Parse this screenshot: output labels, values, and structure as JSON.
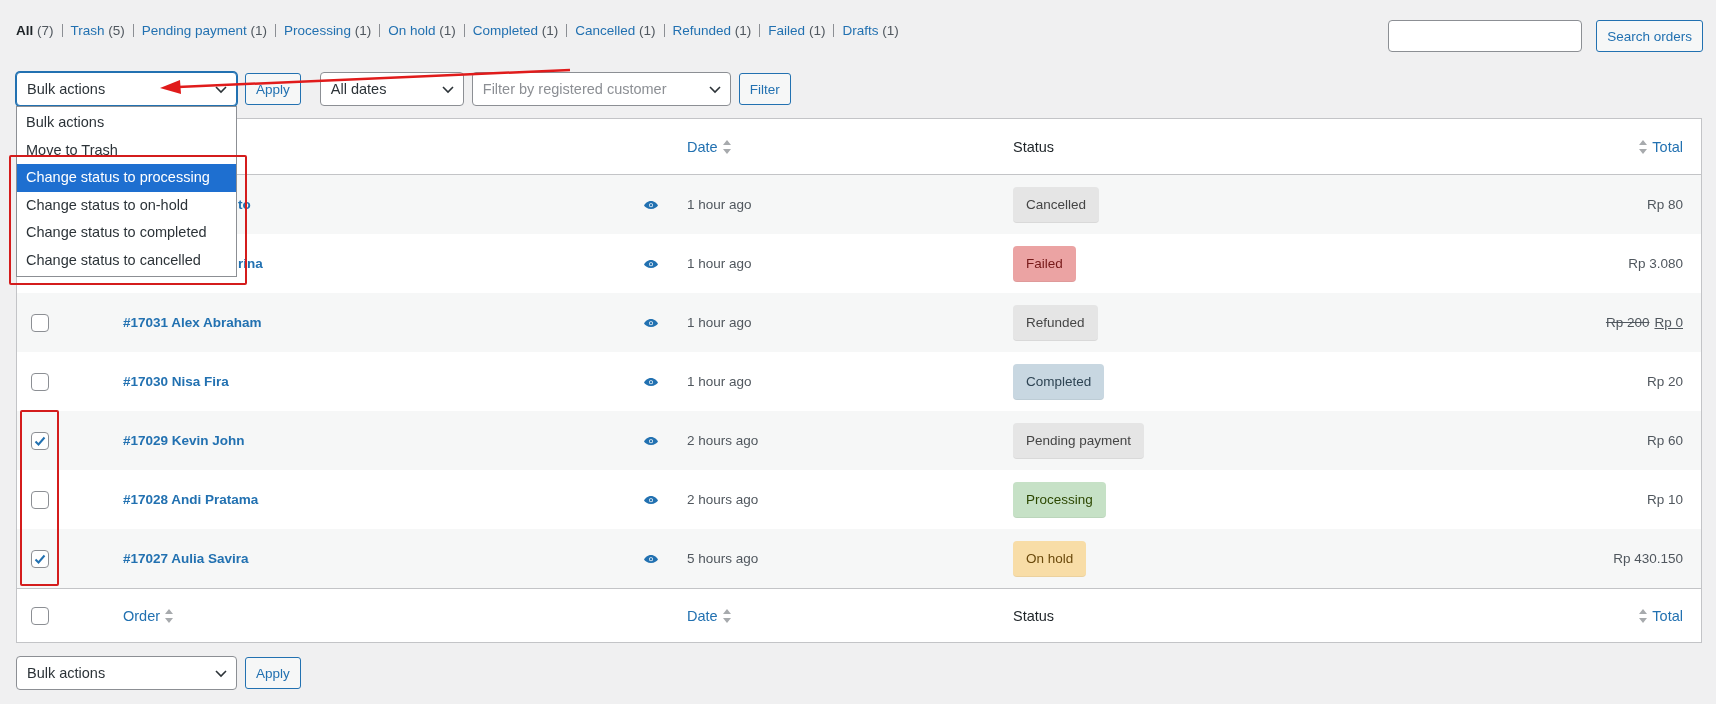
{
  "status_links": [
    {
      "label": "All",
      "count": "(7)",
      "selected": true
    },
    {
      "label": "Trash",
      "count": "(5)",
      "selected": false
    },
    {
      "label": "Pending payment",
      "count": "(1)",
      "selected": false
    },
    {
      "label": "Processing",
      "count": "(1)",
      "selected": false
    },
    {
      "label": "On hold",
      "count": "(1)",
      "selected": false
    },
    {
      "label": "Completed",
      "count": "(1)",
      "selected": false
    },
    {
      "label": "Cancelled",
      "count": "(1)",
      "selected": false
    },
    {
      "label": "Refunded",
      "count": "(1)",
      "selected": false
    },
    {
      "label": "Failed",
      "count": "(1)",
      "selected": false
    },
    {
      "label": "Drafts",
      "count": "(1)",
      "selected": false
    }
  ],
  "search": {
    "button": "Search orders"
  },
  "filters": {
    "bulk_action": "Bulk actions",
    "apply": "Apply",
    "dates": "All dates",
    "customer_placeholder": "Filter by registered customer",
    "filter": "Filter"
  },
  "bulk_menu": [
    {
      "label": "Bulk actions",
      "selected": false
    },
    {
      "label": "Move to Trash",
      "selected": false
    },
    {
      "label": "Change status to processing",
      "selected": true
    },
    {
      "label": "Change status to on-hold",
      "selected": false
    },
    {
      "label": "Change status to completed",
      "selected": false
    },
    {
      "label": "Change status to cancelled",
      "selected": false
    }
  ],
  "table": {
    "header": {
      "date": "Date",
      "status": "Status",
      "total": "Total"
    },
    "rows": [
      {
        "covered": true,
        "order": "to",
        "date": "1 hour ago",
        "status": {
          "label": "Cancelled",
          "kind": "cancelled",
          "color": "#e5e5e5"
        },
        "total": "Rp 80"
      },
      {
        "covered": true,
        "order": "rina",
        "date": "1 hour ago",
        "status": {
          "label": "Failed",
          "kind": "failed",
          "color": "#eba3a3"
        },
        "total": "Rp 3.080"
      },
      {
        "covered": false,
        "checked": false,
        "order": "#17031 Alex Abraham",
        "date": "1 hour ago",
        "status": {
          "label": "Refunded",
          "kind": "refunded",
          "color": "#e5e5e5"
        },
        "total_old": "Rp 200",
        "total": "Rp 0"
      },
      {
        "covered": false,
        "checked": false,
        "order": "#17030 Nisa Fira",
        "date": "1 hour ago",
        "status": {
          "label": "Completed",
          "kind": "completed",
          "color": "#c8d7e1"
        },
        "total": "Rp 20"
      },
      {
        "covered": false,
        "checked": true,
        "order": "#17029 Kevin John",
        "date": "2 hours ago",
        "status": {
          "label": "Pending payment",
          "kind": "pending",
          "color": "#e5e5e5"
        },
        "total": "Rp 60"
      },
      {
        "covered": false,
        "checked": false,
        "order": "#17028 Andi Pratama",
        "date": "2 hours ago",
        "status": {
          "label": "Processing",
          "kind": "processing",
          "color": "#c6e1c6"
        },
        "total": "Rp 10"
      },
      {
        "covered": false,
        "checked": true,
        "order": "#17027 Aulia Savira",
        "date": "5 hours ago",
        "status": {
          "label": "On hold",
          "kind": "onhold",
          "color": "#f8dda7"
        },
        "total": "Rp 430.150"
      }
    ],
    "footer": {
      "checked": false,
      "order": "Order",
      "date": "Date",
      "status": "Status",
      "total": "Total"
    }
  },
  "bottom": {
    "bulk_action": "Bulk actions",
    "apply": "Apply"
  }
}
